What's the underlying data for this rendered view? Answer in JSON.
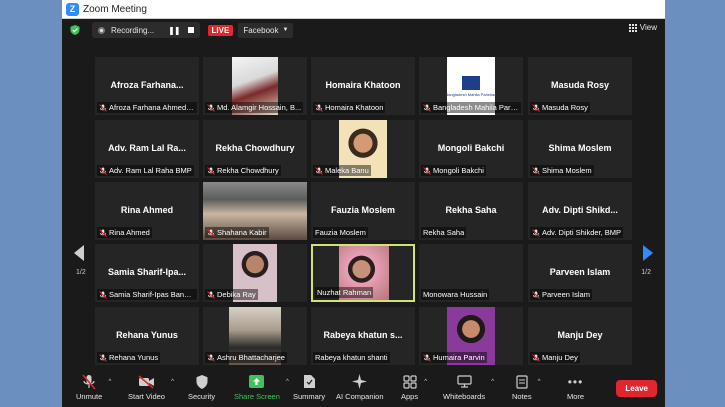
{
  "window": {
    "title": "Zoom Meeting"
  },
  "topbar": {
    "recording_label": "Recording...",
    "live_label": "LIVE",
    "stream_target": "Facebook",
    "view_label": "View"
  },
  "gallery": {
    "page_left": "1/2",
    "page_right": "1/2",
    "tiles": [
      {
        "name": "Afroza  Farhana...",
        "label": "Afroza Farhana Ahmed (...",
        "has_video": false
      },
      {
        "name": "",
        "label": "Md. Alamgir Hossain, B...",
        "has_video": true
      },
      {
        "name": "Homaira Khatoon",
        "label": "Homaira Khatoon",
        "has_video": false
      },
      {
        "name": "",
        "label": "Bangladesh Mahila Paris...",
        "has_video": true,
        "logo_text": "Bangladesh Mahila Parishad"
      },
      {
        "name": "Masuda Rosy",
        "label": "Masuda Rosy",
        "has_video": false
      },
      {
        "name": "Adv. Ram Lal Ra...",
        "label": "Adv. Ram Lal Raha BMP",
        "has_video": false
      },
      {
        "name": "Rekha Chowdhury",
        "label": "Rekha Chowdhury",
        "has_video": false
      },
      {
        "name": "",
        "label": "Maleka Banu",
        "has_video": true
      },
      {
        "name": "Mongoli Bakchi",
        "label": "Mongoli Bakchi",
        "has_video": false
      },
      {
        "name": "Shima Moslem",
        "label": "Shima Moslem",
        "has_video": false
      },
      {
        "name": "Rina Ahmed",
        "label": "Rina Ahmed",
        "has_video": false
      },
      {
        "name": "",
        "label": "Shahana  Kabir",
        "has_video": true
      },
      {
        "name": "Fauzia Moslem",
        "label": "Fauzia Moslem",
        "has_video": false
      },
      {
        "name": "Rekha Saha",
        "label": "Rekha Saha",
        "has_video": false
      },
      {
        "name": "Adv. Dipti Shikd...",
        "label": "Adv. Dipti Shikder, BMP",
        "has_video": false
      },
      {
        "name": "Samia  Sharif-Ipa...",
        "label": "Samia Sharif-Ipas Bangl...",
        "has_video": false
      },
      {
        "name": "",
        "label": "Debika Ray",
        "has_video": true
      },
      {
        "name": "",
        "label": "Nuzhat Rahman",
        "has_video": true
      },
      {
        "name": "",
        "label": "Monowara Hussain",
        "has_video": false
      },
      {
        "name": "Parveen Islam",
        "label": "Parveen Islam",
        "has_video": false
      },
      {
        "name": "Rehana Yunus",
        "label": "Rehana Yunus",
        "has_video": false
      },
      {
        "name": "",
        "label": "Ashru Bhattacharjee",
        "has_video": true
      },
      {
        "name": "Rabeya  khatun  s...",
        "label": "Rabeya khatun shanti",
        "has_video": false
      },
      {
        "name": "",
        "label": "Humaira Parvin",
        "has_video": true
      },
      {
        "name": "Manju Dey",
        "label": "Manju Dey",
        "has_video": false
      }
    ]
  },
  "toolbar": {
    "unmute": "Unmute",
    "start_video": "Start Video",
    "security": "Security",
    "share_screen": "Share Screen",
    "summary": "Summary",
    "ai_companion": "AI Companion",
    "apps": "Apps",
    "whiteboards": "Whiteboards",
    "notes": "Notes",
    "more": "More",
    "leave": "Leave"
  },
  "colors": {
    "accent": "#2d8cff",
    "live": "#e0262f",
    "share_green": "#3fc25a",
    "active_speaker": "#cfe37a"
  }
}
